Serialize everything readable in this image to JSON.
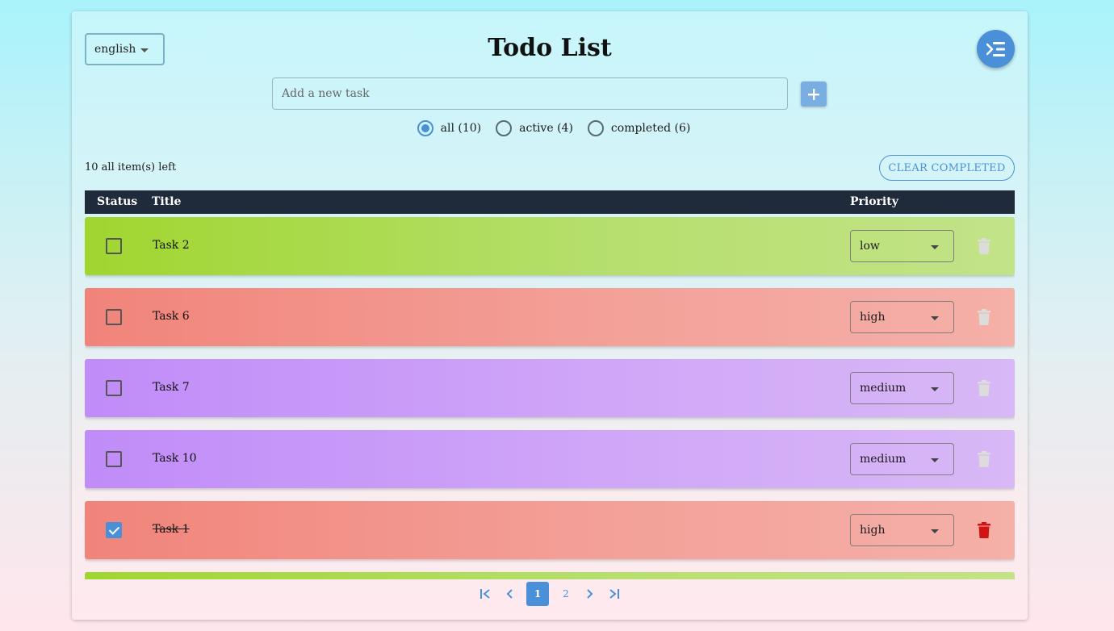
{
  "header": {
    "language": "english",
    "title": "Todo List"
  },
  "input": {
    "placeholder": "Add a new task"
  },
  "filters": [
    {
      "label": "all (10)",
      "selected": true
    },
    {
      "label": "active (4)",
      "selected": false
    },
    {
      "label": "completed (6)",
      "selected": false
    }
  ],
  "status": {
    "items_left": "10 all item(s) left",
    "clear_label": "CLEAR COMPLETED"
  },
  "table": {
    "columns": [
      "Status",
      "Title",
      "Priority"
    ]
  },
  "rows": [
    {
      "title": "Task 2",
      "priority": "low",
      "completed": false,
      "color": "green"
    },
    {
      "title": "Task 6",
      "priority": "high",
      "completed": false,
      "color": "red"
    },
    {
      "title": "Task 7",
      "priority": "medium",
      "completed": false,
      "color": "purple"
    },
    {
      "title": "Task 10",
      "priority": "medium",
      "completed": false,
      "color": "purple"
    },
    {
      "title": "Task 1",
      "priority": "high",
      "completed": true,
      "color": "red"
    },
    {
      "title": "",
      "priority": "",
      "completed": false,
      "color": "green"
    }
  ],
  "pagination": {
    "pages": [
      "1",
      "2"
    ],
    "current": "1"
  },
  "colors": {
    "accent": "#4a90d9",
    "header_bg": "#1f2a3a",
    "delete_active": "#d01414",
    "delete_disabled": "#dcdcdc"
  }
}
